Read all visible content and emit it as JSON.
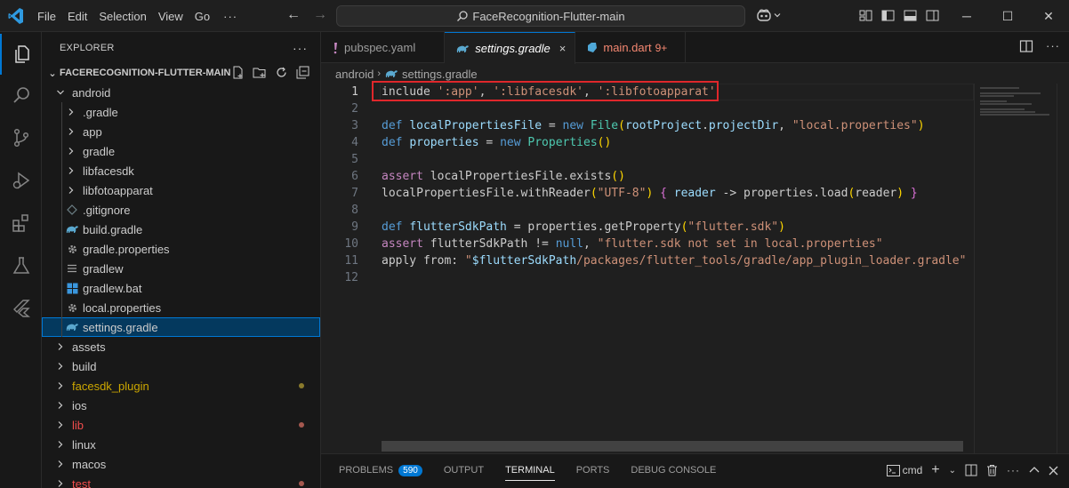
{
  "titlebar": {
    "menu": [
      "File",
      "Edit",
      "Selection",
      "View",
      "Go"
    ],
    "more": "···",
    "search_text": "FaceRecognition-Flutter-main"
  },
  "explorer": {
    "header": "EXPLORER",
    "more": "···",
    "project": "FACERECOGNITION-FLUTTER-MAIN",
    "rows": [
      {
        "label": "android",
        "type": "folder-open",
        "indent": 1
      },
      {
        "label": ".gradle",
        "type": "folder",
        "indent": 2
      },
      {
        "label": "app",
        "type": "folder",
        "indent": 2
      },
      {
        "label": "gradle",
        "type": "folder",
        "indent": 2
      },
      {
        "label": "libfacesdk",
        "type": "folder",
        "indent": 2
      },
      {
        "label": "libfotoapparat",
        "type": "folder",
        "indent": 2
      },
      {
        "label": ".gitignore",
        "type": "file-git",
        "indent": 2
      },
      {
        "label": "build.gradle",
        "type": "file-gradle",
        "indent": 2
      },
      {
        "label": "gradle.properties",
        "type": "file-gear",
        "indent": 2
      },
      {
        "label": "gradlew",
        "type": "file-lines",
        "indent": 2
      },
      {
        "label": "gradlew.bat",
        "type": "file-windows",
        "indent": 2
      },
      {
        "label": "local.properties",
        "type": "file-gear",
        "indent": 2
      },
      {
        "label": "settings.gradle",
        "type": "file-gradle",
        "indent": 2,
        "selected": true
      },
      {
        "label": "assets",
        "type": "folder",
        "indent": 1
      },
      {
        "label": "build",
        "type": "folder",
        "indent": 1
      },
      {
        "label": "facesdk_plugin",
        "type": "folder",
        "indent": 1,
        "color": "#cca700",
        "dot": "#8a7a2c"
      },
      {
        "label": "ios",
        "type": "folder",
        "indent": 1
      },
      {
        "label": "lib",
        "type": "folder",
        "indent": 1,
        "color": "#f14c4c",
        "dot": "#a5584f"
      },
      {
        "label": "linux",
        "type": "folder",
        "indent": 1
      },
      {
        "label": "macos",
        "type": "folder",
        "indent": 1
      },
      {
        "label": "test",
        "type": "folder",
        "indent": 1,
        "color": "#f14c4c",
        "dot": "#a5584f"
      }
    ]
  },
  "tabs": [
    {
      "label": "pubspec.yaml",
      "icon": "exclamation-icon"
    },
    {
      "label": "settings.gradle",
      "icon": "gradle-icon",
      "active": true,
      "close": "×"
    },
    {
      "label": "main.dart",
      "icon": "dart-icon",
      "badge": "9+",
      "error": true
    }
  ],
  "breadcrumb": {
    "folder": "android",
    "file": "settings.gradle"
  },
  "editor": {
    "lines": [
      {
        "n": "1",
        "tokens": [
          [
            "n",
            "include "
          ],
          [
            "s",
            "':app'"
          ],
          [
            "n",
            ", "
          ],
          [
            "s",
            "':libfacesdk'"
          ],
          [
            "n",
            ", "
          ],
          [
            "s",
            "':libfotoapparat'"
          ]
        ]
      },
      {
        "n": "2",
        "tokens": []
      },
      {
        "n": "3",
        "tokens": [
          [
            "kw",
            "def "
          ],
          [
            "v",
            "localPropertiesFile"
          ],
          [
            "n",
            " = "
          ],
          [
            "kw",
            "new "
          ],
          [
            "t",
            "File"
          ],
          [
            "b",
            "("
          ],
          [
            "v",
            "rootProject"
          ],
          [
            "n",
            "."
          ],
          [
            "v",
            "projectDir"
          ],
          [
            "n",
            ", "
          ],
          [
            "s",
            "\"local.properties\""
          ],
          [
            "b",
            ")"
          ]
        ]
      },
      {
        "n": "4",
        "tokens": [
          [
            "kw",
            "def "
          ],
          [
            "v",
            "properties"
          ],
          [
            "n",
            " = "
          ],
          [
            "kw",
            "new "
          ],
          [
            "t",
            "Properties"
          ],
          [
            "b",
            "()"
          ]
        ]
      },
      {
        "n": "5",
        "tokens": []
      },
      {
        "n": "6",
        "tokens": [
          [
            "k",
            "assert "
          ],
          [
            "n",
            "localPropertiesFile.exists"
          ],
          [
            "b",
            "()"
          ]
        ]
      },
      {
        "n": "7",
        "tokens": [
          [
            "n",
            "localPropertiesFile.withReader"
          ],
          [
            "b",
            "("
          ],
          [
            "s",
            "\"UTF-8\""
          ],
          [
            "b",
            ")"
          ],
          [
            "n",
            " "
          ],
          [
            "b2",
            "{"
          ],
          [
            "n",
            " "
          ],
          [
            "v",
            "reader"
          ],
          [
            "n",
            " -> properties.load"
          ],
          [
            "b",
            "("
          ],
          [
            "n",
            "reader"
          ],
          [
            "b",
            ")"
          ],
          [
            "n",
            " "
          ],
          [
            "b2",
            "}"
          ]
        ]
      },
      {
        "n": "8",
        "tokens": []
      },
      {
        "n": "9",
        "tokens": [
          [
            "kw",
            "def "
          ],
          [
            "v",
            "flutterSdkPath"
          ],
          [
            "n",
            " = properties.getProperty"
          ],
          [
            "b",
            "("
          ],
          [
            "s",
            "\"flutter.sdk\""
          ],
          [
            "b",
            ")"
          ]
        ]
      },
      {
        "n": "10",
        "tokens": [
          [
            "k",
            "assert "
          ],
          [
            "n",
            "flutterSdkPath != "
          ],
          [
            "kw",
            "null"
          ],
          [
            "n",
            ", "
          ],
          [
            "s",
            "\"flutter.sdk not set in local.properties\""
          ]
        ]
      },
      {
        "n": "11",
        "tokens": [
          [
            "n",
            "apply from: "
          ],
          [
            "s",
            "\""
          ],
          [
            "v",
            "$flutterSdkPath"
          ],
          [
            "s",
            "/packages/flutter_tools/gradle/app_plugin_loader.gradle\""
          ]
        ]
      },
      {
        "n": "12",
        "tokens": []
      }
    ]
  },
  "panel": {
    "tabs": [
      "PROBLEMS",
      "OUTPUT",
      "TERMINAL",
      "PORTS",
      "DEBUG CONSOLE"
    ],
    "problems_count": "590",
    "active": "TERMINAL",
    "terminal_name": "cmd"
  },
  "colors": {
    "accent": "#0078d4",
    "highlight": "#e0272b"
  }
}
